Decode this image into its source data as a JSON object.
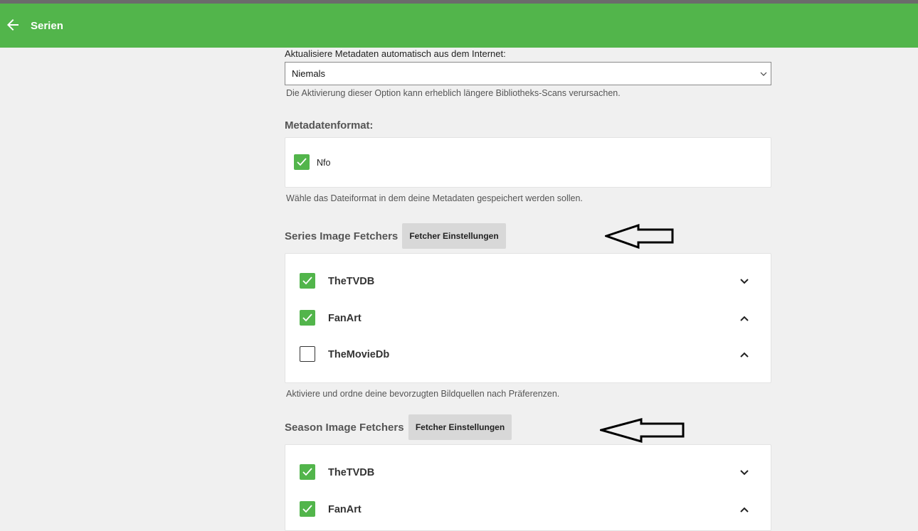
{
  "appbar": {
    "title": "Serien",
    "back_icon": "arrow-left-icon",
    "color": "#52b54b"
  },
  "metadata_refresh": {
    "label": "Aktualisiere Metadaten automatisch aus dem Internet:",
    "selected": "Niemals",
    "help": "Die Aktivierung dieser Option kann erheblich längere Bibliotheks-Scans verursachen."
  },
  "metadata_format": {
    "title": "Metadatenformat:",
    "option": {
      "label": "Nfo",
      "checked": true
    },
    "help": "Wähle das Dateiformat in dem deine Metadaten gespeichert werden sollen."
  },
  "series_fetchers": {
    "title": "Series Image Fetchers",
    "button": "Fetcher Einstellungen",
    "items": [
      {
        "label": "TheTVDB",
        "checked": true,
        "chevron": "chevron-down-icon"
      },
      {
        "label": "FanArt",
        "checked": true,
        "chevron": "chevron-up-icon"
      },
      {
        "label": "TheMovieDb",
        "checked": false,
        "chevron": "chevron-up-icon"
      }
    ],
    "help": "Aktiviere und ordne deine bevorzugten Bildquellen nach Präferenzen."
  },
  "season_fetchers": {
    "title": "Season Image Fetchers",
    "button": "Fetcher Einstellungen",
    "items": [
      {
        "label": "TheTVDB",
        "checked": true,
        "chevron": "chevron-down-icon"
      },
      {
        "label": "FanArt",
        "checked": true,
        "chevron": "chevron-up-icon"
      }
    ]
  }
}
